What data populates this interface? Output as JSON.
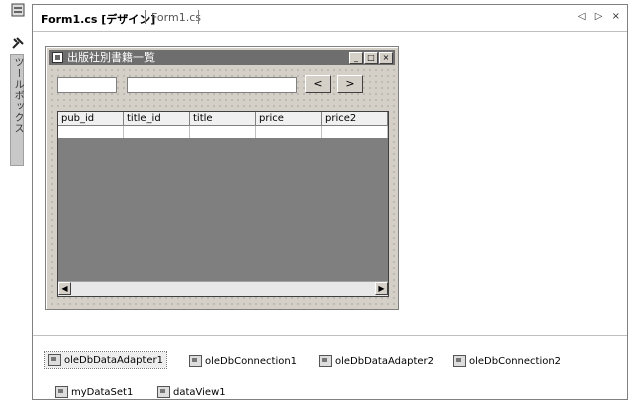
{
  "sidebar": {
    "toolbox_label": "ツールボックス"
  },
  "tabs": [
    {
      "label": "Form1.cs [デザイン]",
      "active": true
    },
    {
      "label": "Form1.cs",
      "active": false
    }
  ],
  "tab_controls": {
    "prev": "◁",
    "next": "▷",
    "close": "×"
  },
  "form": {
    "title": "出版社別書籍一覧",
    "window_buttons": {
      "minimize": "_",
      "maximize": "□",
      "close": "×"
    },
    "prev_button": "<",
    "next_button": ">",
    "grid": {
      "columns": [
        "pub_id",
        "title_id",
        "title",
        "price",
        "price2"
      ]
    },
    "scroll": {
      "left": "◀",
      "right": "▶"
    }
  },
  "components": [
    {
      "label": "oleDbDataAdapter1",
      "icon": "data-adapter-icon",
      "selected": true
    },
    {
      "label": "oleDbConnection1",
      "icon": "connection-icon",
      "selected": false
    },
    {
      "label": "oleDbDataAdapter2",
      "icon": "data-adapter-icon",
      "selected": false
    },
    {
      "label": "oleDbConnection2",
      "icon": "connection-icon",
      "selected": false
    },
    {
      "label": "myDataSet1",
      "icon": "dataset-icon",
      "selected": false
    },
    {
      "label": "dataView1",
      "icon": "dataview-icon",
      "selected": false
    }
  ]
}
